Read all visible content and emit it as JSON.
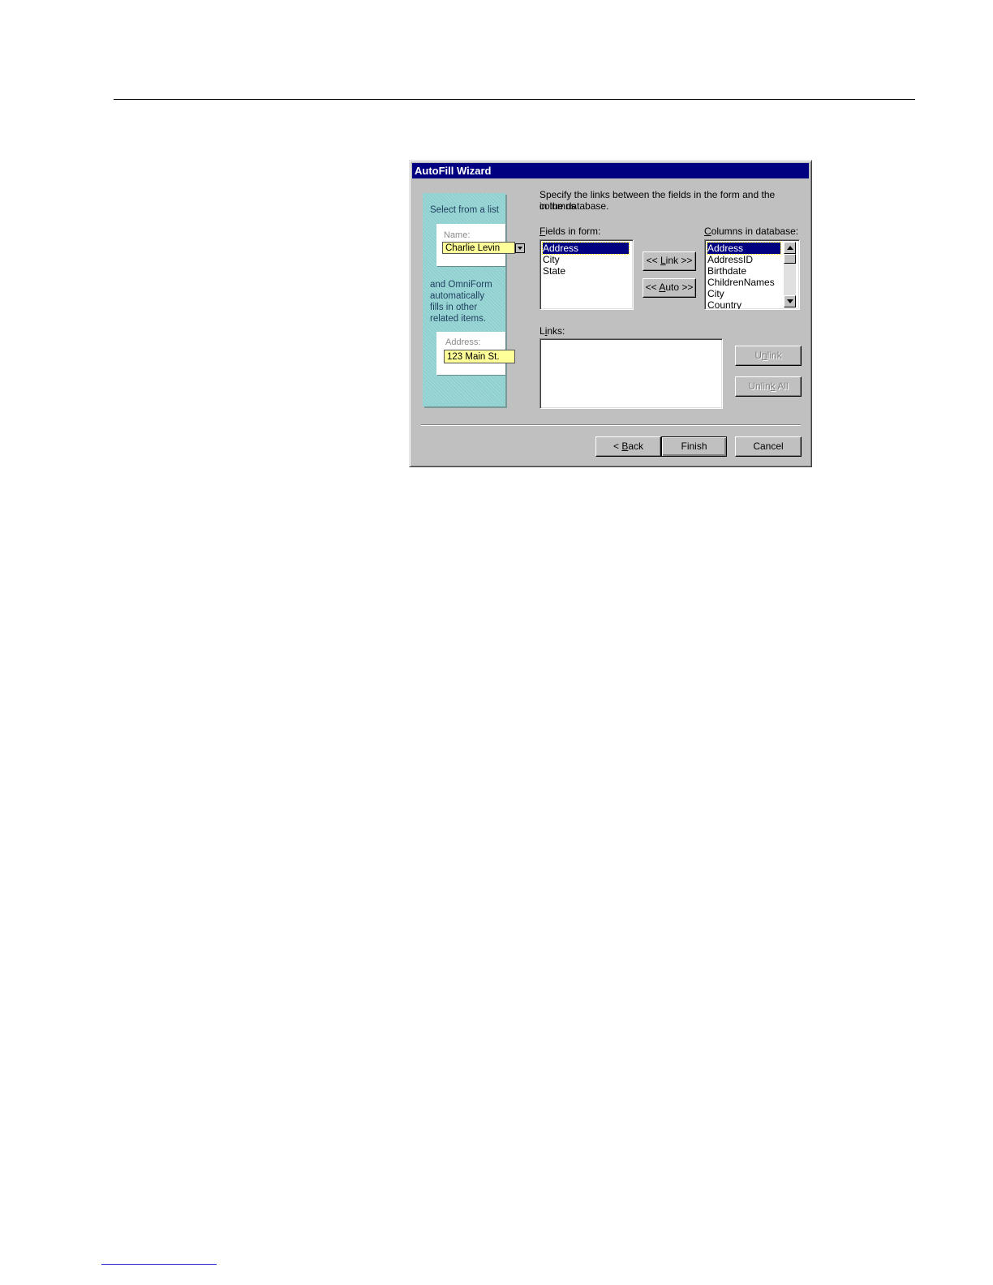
{
  "dialog": {
    "title": "AutoFill Wizard",
    "instructions_line1": "Specify the links between the fields in the form and the columns",
    "instructions_line2": "in the database.",
    "illustration": {
      "heading": "Select from a list",
      "name_label": "Name:",
      "name_value": "Charlie Levin",
      "caption_lines": [
        "and OmniForm",
        "automatically",
        "fills in other",
        "related items."
      ],
      "address_label": "Address:",
      "address_value": "123 Main St."
    },
    "fields_label_mnemonic": "F",
    "fields_label_rest": "ields in form:",
    "fields_items": [
      "Address",
      "City",
      "State"
    ],
    "fields_selected": "Address",
    "columns_label_mnemonic": "C",
    "columns_label_rest": "olumns in database:",
    "columns_items": [
      "Address",
      "AddressID",
      "Birthdate",
      "ChildrenNames",
      "City",
      "Country"
    ],
    "columns_selected": "Address",
    "link_button": {
      "pre": "<< ",
      "mnemonic": "L",
      "post": "ink >>"
    },
    "auto_button": {
      "pre": "<< ",
      "mnemonic": "A",
      "post": "uto >>"
    },
    "links_label_mnemonic": "i",
    "links_label_pre": "L",
    "links_label_post": "nks:",
    "unlink_button": {
      "pre": "U",
      "mnemonic": "n",
      "post": "link"
    },
    "unlink_all_button": {
      "pre": "Unlin",
      "mnemonic": "k",
      "post": " All"
    },
    "back_button": {
      "pre": "< ",
      "mnemonic": "B",
      "post": "ack"
    },
    "finish_label": "Finish",
    "cancel_label": "Cancel"
  },
  "colors": {
    "title_bar": "#000080",
    "dialog_face": "#c0c0c0",
    "illustration_bg": "#8fd0d0",
    "highlight_field": "#ffff99"
  }
}
